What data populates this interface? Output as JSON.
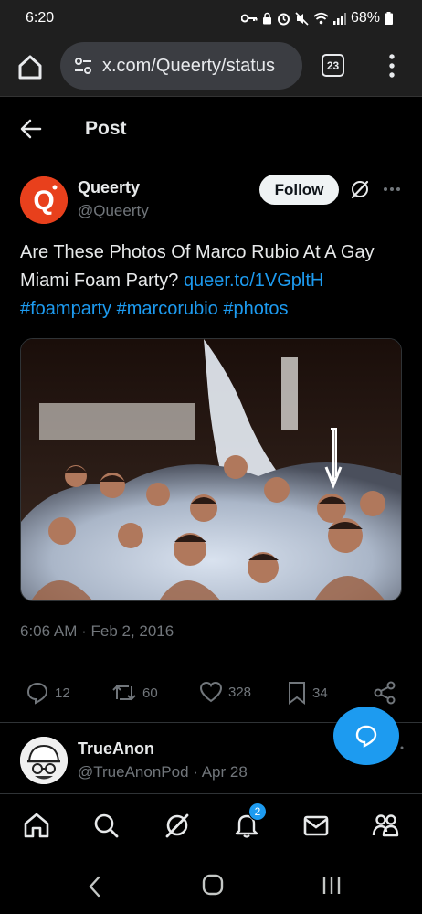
{
  "status_bar": {
    "time": "6:20",
    "battery": "68%"
  },
  "browser": {
    "url": "x.com/Queerty/status",
    "tab_count": "23"
  },
  "header": {
    "title": "Post"
  },
  "tweet": {
    "author_name": "Queerty",
    "author_handle": "@Queerty",
    "avatar_letter": "Q",
    "follow_label": "Follow",
    "text": "Are These Photos Of Marco Rubio At A Gay Miami Foam Party?",
    "link": "queer.to/1VGpltH",
    "hashtags": [
      "#foamparty",
      "#marcorubio",
      "#photos"
    ],
    "timestamp": "6:06 AM · Feb 2, 2016",
    "replies": "12",
    "reposts": "60",
    "likes": "328",
    "bookmarks": "34"
  },
  "reply": {
    "author_name": "TrueAnon",
    "meta": "@TrueAnonPod · Apr 28"
  },
  "bottom_nav": {
    "notification_count": "2"
  },
  "colors": {
    "accent": "#1d9bf0",
    "brand_q": "#e8401c",
    "background": "#000000",
    "muted": "#71767b"
  }
}
